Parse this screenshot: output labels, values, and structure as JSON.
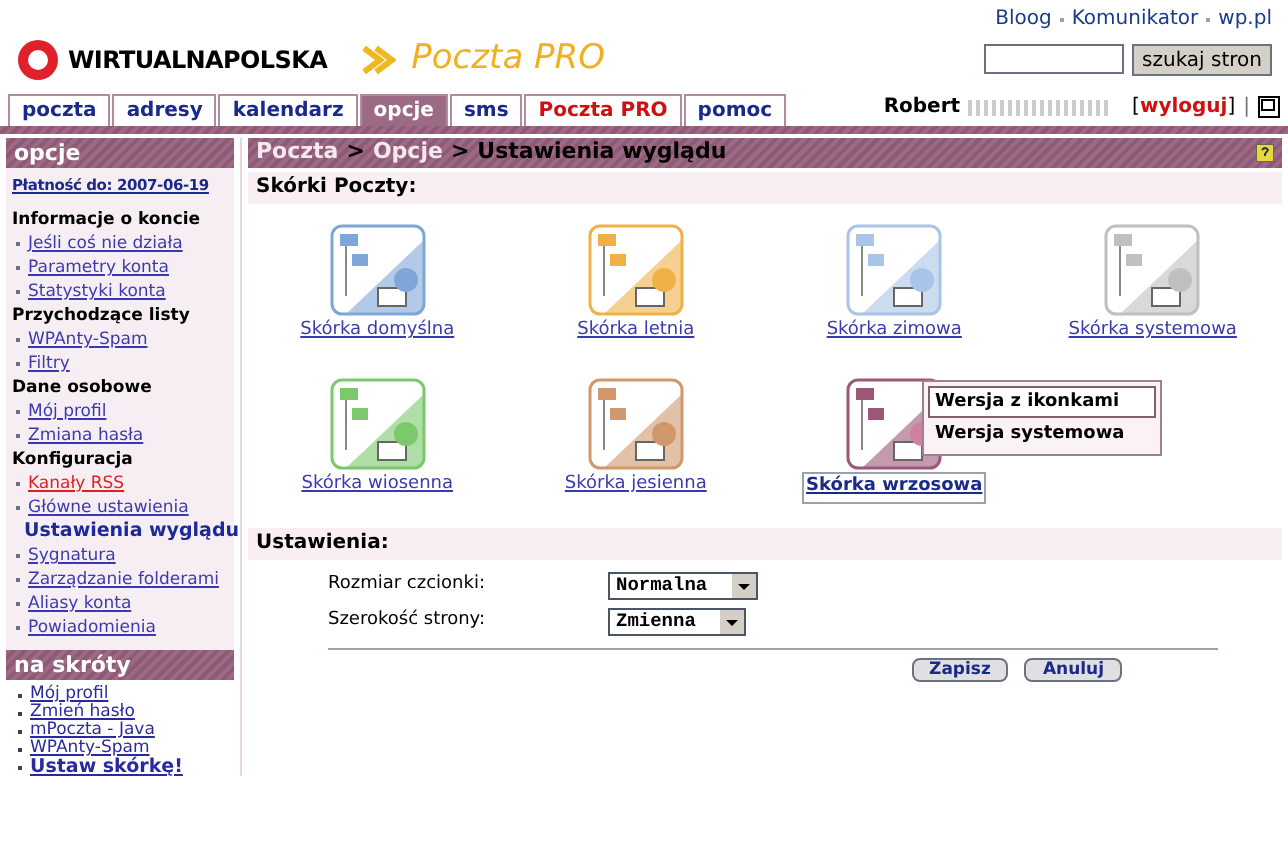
{
  "header": {
    "logo_text": "WIRTUALNAPOLSKA",
    "product": "Poczta PRO",
    "top_links": [
      "Bloog",
      "Komunikator",
      "wp.pl"
    ],
    "search_button": "szukaj stron"
  },
  "tabs": [
    {
      "label": "poczta",
      "selected": false,
      "highlight": false
    },
    {
      "label": "adresy",
      "selected": false,
      "highlight": false
    },
    {
      "label": "kalendarz",
      "selected": false,
      "highlight": false
    },
    {
      "label": "opcje",
      "selected": true,
      "highlight": false
    },
    {
      "label": "sms",
      "selected": false,
      "highlight": false
    },
    {
      "label": "Poczta PRO",
      "selected": false,
      "highlight": true
    },
    {
      "label": "pomoc",
      "selected": false,
      "highlight": false
    }
  ],
  "user": {
    "name": "Robert",
    "logout_open": "[",
    "logout": "wyloguj",
    "logout_close": "]",
    "separator": "|"
  },
  "sidebar": {
    "title": "opcje",
    "payment": "Płatność do: 2007-06-19",
    "items": [
      {
        "kind": "header",
        "label": "Informacje o koncie"
      },
      {
        "kind": "link",
        "label": "Jeśli coś nie działa",
        "selected": false,
        "highlight": false
      },
      {
        "kind": "link",
        "label": "Parametry konta",
        "selected": false,
        "highlight": false
      },
      {
        "kind": "link",
        "label": "Statystyki konta",
        "selected": false,
        "highlight": false
      },
      {
        "kind": "header",
        "label": "Przychodzące listy"
      },
      {
        "kind": "link",
        "label": "WPAnty-Spam",
        "selected": false,
        "highlight": false
      },
      {
        "kind": "link",
        "label": "Filtry",
        "selected": false,
        "highlight": false
      },
      {
        "kind": "header",
        "label": "Dane osobowe"
      },
      {
        "kind": "link",
        "label": "Mój profil",
        "selected": false,
        "highlight": false
      },
      {
        "kind": "link",
        "label": "Zmiana hasła",
        "selected": false,
        "highlight": false
      },
      {
        "kind": "header",
        "label": "Konfiguracja"
      },
      {
        "kind": "link",
        "label": "Kanały RSS",
        "selected": false,
        "highlight": true
      },
      {
        "kind": "link",
        "label": "Główne ustawienia",
        "selected": false,
        "highlight": false
      },
      {
        "kind": "link",
        "label": "Ustawienia wyglądu",
        "selected": true,
        "highlight": false
      },
      {
        "kind": "link",
        "label": "Sygnatura",
        "selected": false,
        "highlight": false
      },
      {
        "kind": "link",
        "label": "Zarządzanie folderami",
        "selected": false,
        "highlight": false
      },
      {
        "kind": "link",
        "label": "Aliasy konta",
        "selected": false,
        "highlight": false
      },
      {
        "kind": "link",
        "label": "Powiadomienia",
        "selected": false,
        "highlight": false
      }
    ],
    "shortcuts_title": "na skróty",
    "shortcuts": [
      {
        "label": "Mój profil",
        "bold": false
      },
      {
        "label": "Zmień hasło",
        "bold": false
      },
      {
        "label": "mPoczta - Java",
        "bold": false
      },
      {
        "label": "WPAnty-Spam",
        "bold": false
      },
      {
        "label": "Ustaw skórkę!",
        "bold": true
      }
    ]
  },
  "breadcrumb": [
    "Poczta",
    "Opcje",
    "Ustawienia wyglądu"
  ],
  "breadcrumb_separator": ">",
  "skins_title": "Skórki Poczty:",
  "skins": [
    {
      "label": "Skórka domyślna",
      "color": "#7fa6d8",
      "selected": false
    },
    {
      "label": "Skórka letnia",
      "color": "#f0b048",
      "selected": false
    },
    {
      "label": "Skórka zimowa",
      "color": "#a8c4e8",
      "selected": false
    },
    {
      "label": "Skórka systemowa",
      "color": "#c0c0c0",
      "selected": false
    },
    {
      "label": "Skórka wiosenna",
      "color": "#7cc86c",
      "selected": false
    },
    {
      "label": "Skórka jesienna",
      "color": "#d0986c",
      "selected": false
    },
    {
      "label": "Skórka wrzosowa",
      "color": "#9c5878",
      "selected": true
    }
  ],
  "popup_menu": [
    {
      "label": "Wersja z ikonkami",
      "selected": true
    },
    {
      "label": "Wersja systemowa",
      "selected": false
    }
  ],
  "settings_title": "Ustawienia:",
  "settings": [
    {
      "label": "Rozmiar czcionki:",
      "value": "Normalna"
    },
    {
      "label": "Szerokość strony:",
      "value": "Zmienna"
    }
  ],
  "buttons": [
    "Zapisz",
    "Anuluj"
  ]
}
